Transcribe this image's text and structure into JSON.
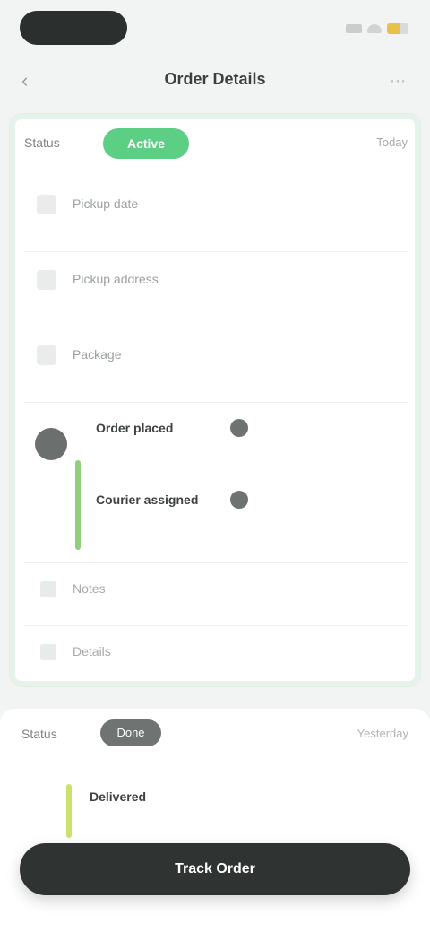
{
  "nav": {
    "back_icon": "chevron-left-icon",
    "title": "Order Details",
    "more_icon": "more-icon"
  },
  "card": {
    "label": "Status",
    "chip": "Active",
    "date": "Today",
    "rows": [
      {
        "icon": "calendar-icon",
        "text": "Pickup date",
        "value": ""
      },
      {
        "icon": "location-icon",
        "text": "Pickup address",
        "value": ""
      },
      {
        "icon": "package-icon",
        "text": "Package",
        "value": ""
      }
    ],
    "timeline": [
      {
        "title": "Order placed",
        "sub": "",
        "meta": ""
      },
      {
        "title": "Courier assigned",
        "sub": "",
        "meta": ""
      }
    ],
    "footer": [
      {
        "icon": "note-icon",
        "text": "Notes"
      },
      {
        "icon": "info-icon",
        "text": "Details"
      }
    ]
  },
  "section2": {
    "label": "Status",
    "chip": "Done",
    "date": "Yesterday",
    "item_title": "Delivered",
    "item_sub": ""
  },
  "cta": {
    "label": "Track Order"
  },
  "colors": {
    "accent": "#5ccf84",
    "dark": "#2f3332"
  }
}
